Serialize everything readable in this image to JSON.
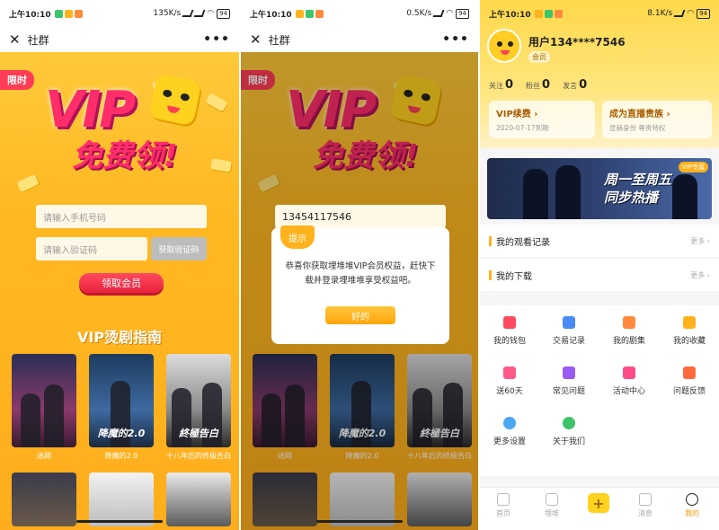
{
  "status": {
    "time": "上午10:10",
    "speed_1": "135K/s",
    "speed_2": "0.5K/s",
    "speed_3": "8.1K/s",
    "battery": "94"
  },
  "nav": {
    "close": "✕",
    "title": "社群",
    "more": "•••"
  },
  "promo": {
    "limit_tag": "限时",
    "headline_vip": "VIP",
    "headline_free": "免费领!",
    "phone_placeholder": "请输入手机号码",
    "code_placeholder": "请输入验证码",
    "get_code": "获取验证码",
    "claim": "领取会员",
    "guide_title": "VIP烫剧指南",
    "posters": [
      {
        "caption": "迷网",
        "art": ""
      },
      {
        "caption": "降魔的2.0",
        "art": "降魔的2.0"
      },
      {
        "caption": "十八年后的终极告白",
        "art": "終極告白"
      }
    ]
  },
  "dialog": {
    "phone_value": "13454117546",
    "badge": "提示",
    "message": "恭喜你获取埋堆堆VIP会员权益，赶快下载并登录埋堆堆享受权益吧。",
    "ok": "好的"
  },
  "profile": {
    "username": "用户134****7546",
    "member_badge": "会员",
    "stats": [
      {
        "label": "关注",
        "value": "0"
      },
      {
        "label": "粉丝",
        "value": "0"
      },
      {
        "label": "发言",
        "value": "0"
      }
    ],
    "vip_card": {
      "title": "VIP续费 ›",
      "sub": "2020-07-17到期"
    },
    "live_card": {
      "title": "成为直播贵族 ›",
      "sub": "显赫身份 尊贵特权"
    },
    "banner_text_1": "周一至周五",
    "banner_text_2": "同步热播",
    "banner_tag": "VIP专属",
    "watch_history": "我的观看记录",
    "downloads": "我的下载",
    "more": "更多 ›",
    "grid": [
      {
        "label": "我的钱包",
        "color": "#ff4b5f"
      },
      {
        "label": "交易记录",
        "color": "#4a8af4"
      },
      {
        "label": "我的剧集",
        "color": "#ff8a3d"
      },
      {
        "label": "我的收藏",
        "color": "#ffb21c"
      },
      {
        "label": "送60天",
        "color": "#ff5a8a"
      },
      {
        "label": "常见问题",
        "color": "#9a5af4"
      },
      {
        "label": "活动中心",
        "color": "#ff4b8a"
      },
      {
        "label": "问题反馈",
        "color": "#ff6a3d"
      },
      {
        "label": "更多设置",
        "color": "#4aa8f4"
      },
      {
        "label": "关于我们",
        "color": "#3dc46a"
      }
    ],
    "tabs": [
      "首页",
      "埋堆",
      "+",
      "消息",
      "我的"
    ]
  }
}
